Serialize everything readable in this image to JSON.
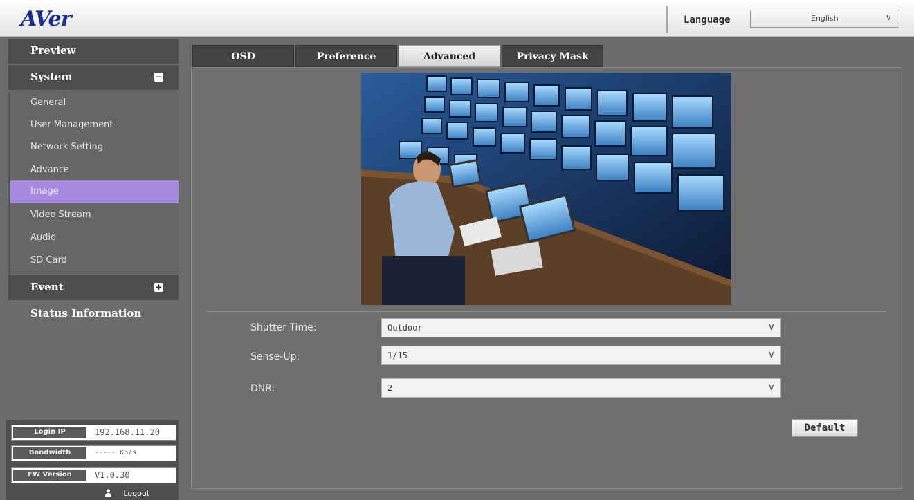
{
  "header": {
    "logo": "AVer",
    "language_label": "Language",
    "language_value": "English"
  },
  "sidebar": {
    "preview": "Preview",
    "system": "System",
    "system_toggle": "−",
    "items": [
      {
        "label": "General"
      },
      {
        "label": "User Management"
      },
      {
        "label": "Network Setting"
      },
      {
        "label": "Advance"
      },
      {
        "label": "Image",
        "active": true
      },
      {
        "label": "Video Stream"
      },
      {
        "label": "Audio"
      },
      {
        "label": "SD Card"
      }
    ],
    "event": "Event",
    "event_toggle": "+",
    "status": "Status Information"
  },
  "info": {
    "login_ip_label": "Login IP",
    "login_ip_value": "192.168.11.20",
    "bandwidth_label": "Bandwidth",
    "bandwidth_value": "----- Kb/s",
    "fw_label": "FW Version",
    "fw_value": "V1.0.30",
    "logout": "Logout"
  },
  "tabs": [
    {
      "label": "OSD"
    },
    {
      "label": "Preference"
    },
    {
      "label": "Advanced",
      "active": true
    },
    {
      "label": "Privacy Mask"
    }
  ],
  "form": {
    "shutter_label": "Shutter Time:",
    "shutter_value": "Outdoor",
    "senseup_label": "Sense-Up:",
    "senseup_value": "1/15",
    "dnr_label": "DNR:",
    "dnr_value": "2",
    "default_button": "Default"
  },
  "icons": {
    "dropdown": "chevron-down-icon",
    "user": "user-icon"
  },
  "colors": {
    "active_item": "#a58ae0",
    "logo": "#1d2f8c",
    "panel": "#6b6b6b"
  }
}
